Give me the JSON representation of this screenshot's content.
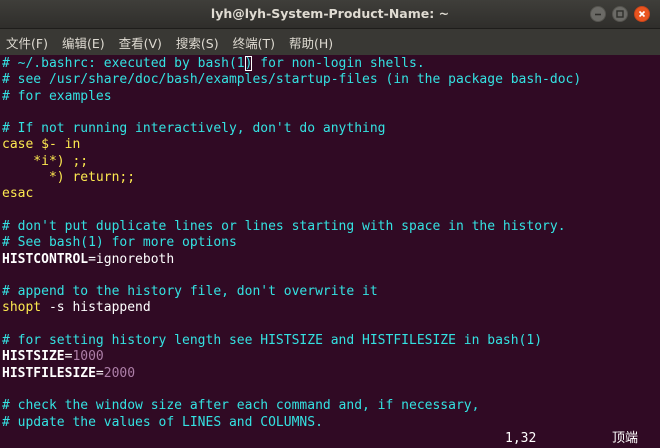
{
  "window": {
    "title": "lyh@lyh-System-Product-Name: ~"
  },
  "menu": {
    "items": [
      {
        "label": "文件(F)"
      },
      {
        "label": "编辑(E)"
      },
      {
        "label": "查看(V)"
      },
      {
        "label": "搜索(S)"
      },
      {
        "label": "终端(T)"
      },
      {
        "label": "帮助(H)"
      }
    ]
  },
  "editor": {
    "colors": {
      "background": "#300a24",
      "comment": "#34e2e2",
      "keyword": "#fce94f",
      "number": "#ad7fa8",
      "text": "#ffffff"
    },
    "line1": {
      "pre": "# ~/.bashrc: executed by bash(1",
      "cursor": ")",
      "post": " for non-login shells."
    },
    "line2": "# see /usr/share/doc/bash/examples/startup-files (in the package bash-doc)",
    "line3": "# for examples",
    "line4": "",
    "line5": "# If not running interactively, don't do anything",
    "line6": {
      "keyword": "case",
      "rest": " $- in"
    },
    "line7": "    *i*) ;;",
    "line8": {
      "indent": "      *) ",
      "statement": "return",
      "rest": ";;"
    },
    "line9": "esac",
    "line10": "",
    "line11": "# don't put duplicate lines or lines starting with space in the history.",
    "line12": "# See bash(1) for more options",
    "line13": {
      "name": "HISTCONTROL",
      "eq": "=",
      "value": "ignoreboth"
    },
    "line14": "",
    "line15": "# append to the history file, don't overwrite it",
    "line16": {
      "cmd": "shopt",
      "rest": " -s histappend"
    },
    "line17": "",
    "line18": "# for setting history length see HISTSIZE and HISTFILESIZE in bash(1)",
    "line19": {
      "name": "HISTSIZE",
      "eq": "=",
      "value": "1000"
    },
    "line20": {
      "name": "HISTFILESIZE",
      "eq": "=",
      "value": "2000"
    },
    "line21": "",
    "line22": "# check the window size after each command and, if necessary,",
    "line23": "# update the values of LINES and COLUMNS."
  },
  "status": {
    "cursor_position": "1,32",
    "scroll_position": "顶端"
  }
}
